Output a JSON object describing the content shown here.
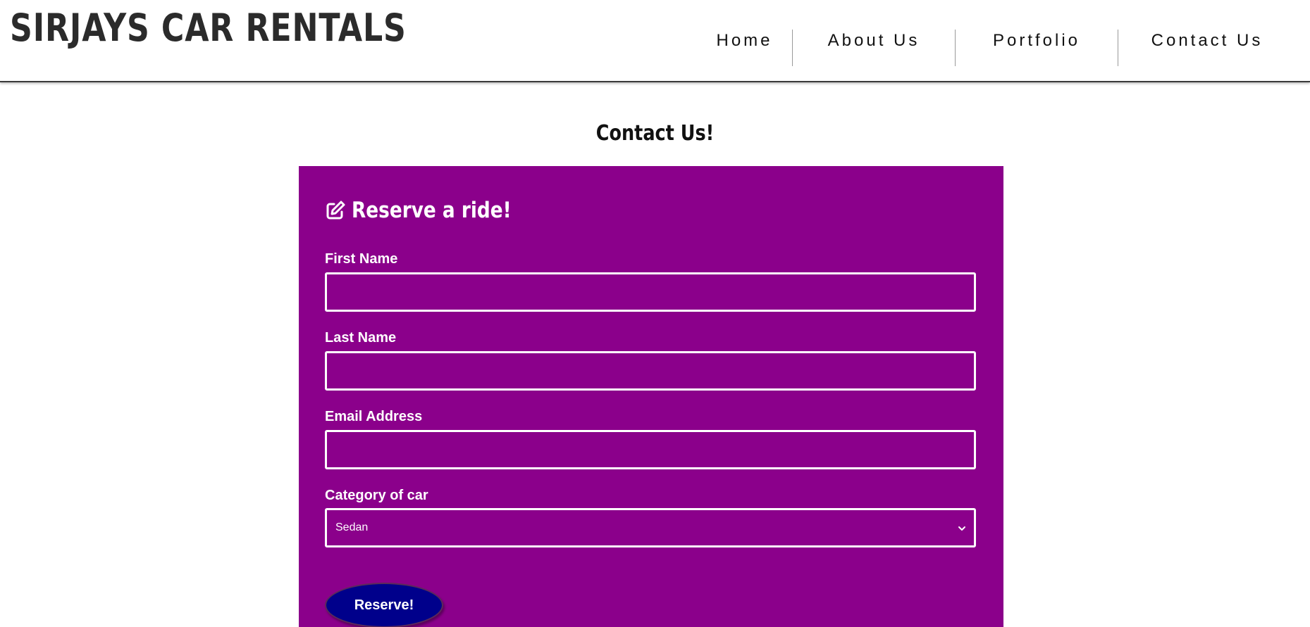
{
  "header": {
    "brand": "SIRJAYS CAR RENTALS",
    "nav": {
      "home": "Home",
      "about": "About Us",
      "portfolio": "Portfolio",
      "contact": "Contact Us"
    }
  },
  "main": {
    "title": "Contact Us!",
    "form": {
      "heading": "Reserve a ride!",
      "heading_icon": "edit-icon",
      "first_name_label": "First Name",
      "first_name_value": "",
      "last_name_label": "Last Name",
      "last_name_value": "",
      "email_label": "Email Address",
      "email_value": "",
      "category_label": "Category of car",
      "category_selected": "Sedan",
      "submit_label": "Reserve!"
    }
  },
  "colors": {
    "form_background": "#8b008b",
    "button_background": "#00008b",
    "text_light": "#ffffff",
    "brand_text": "#2b2b2b"
  }
}
